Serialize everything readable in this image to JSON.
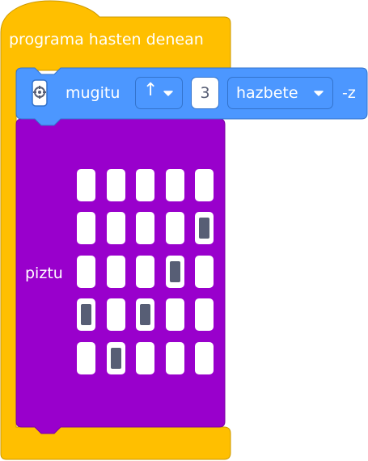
{
  "hat_block": {
    "label": "programa hasten denean",
    "color": "#FFBF00"
  },
  "move_block": {
    "icon": "motor-icon",
    "label": "mugitu",
    "direction": "↑",
    "amount": "3",
    "unit": "hazbete",
    "suffix": "-z",
    "color": "#4C97FF"
  },
  "light_block": {
    "label": "piztu",
    "color": "#9900CC",
    "matrix": [
      [
        0,
        0,
        0,
        0,
        0
      ],
      [
        0,
        0,
        0,
        0,
        1
      ],
      [
        0,
        0,
        0,
        1,
        0
      ],
      [
        1,
        0,
        1,
        0,
        0
      ],
      [
        0,
        1,
        0,
        0,
        0
      ]
    ]
  }
}
